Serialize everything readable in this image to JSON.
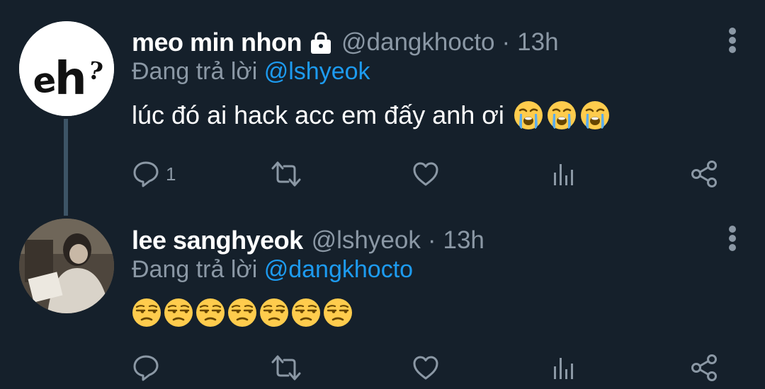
{
  "tweets": [
    {
      "name": "meo min nhon",
      "protected": true,
      "handle": "@dangkhocto",
      "separator": "·",
      "time": "13h",
      "reply_prefix": "Đang trả lời",
      "reply_to": "@lshyeok",
      "text": "lúc đó ai hack acc em đấy anh ơi",
      "emojis": [
        "loudly-crying-face",
        "loudly-crying-face",
        "loudly-crying-face"
      ],
      "reply_count": "1",
      "avatar_text": "eh?"
    },
    {
      "name": "lee sanghyeok",
      "protected": false,
      "handle": "@lshyeok",
      "separator": "·",
      "time": "13h",
      "reply_prefix": "Đang trả lời",
      "reply_to": "@dangkhocto",
      "text": "",
      "emojis": [
        "unamused-face",
        "unamused-face",
        "unamused-face",
        "unamused-face",
        "unamused-face",
        "unamused-face",
        "unamused-face"
      ],
      "reply_count": "",
      "avatar_text": ""
    }
  ],
  "action_icons": [
    "reply-icon",
    "retweet-icon",
    "like-icon",
    "analytics-icon",
    "share-icon"
  ],
  "colors": {
    "background": "#15202b",
    "text": "#ffffff",
    "muted": "#8b98a5",
    "link": "#1d9bf0",
    "thread_line": "#3d5466"
  }
}
